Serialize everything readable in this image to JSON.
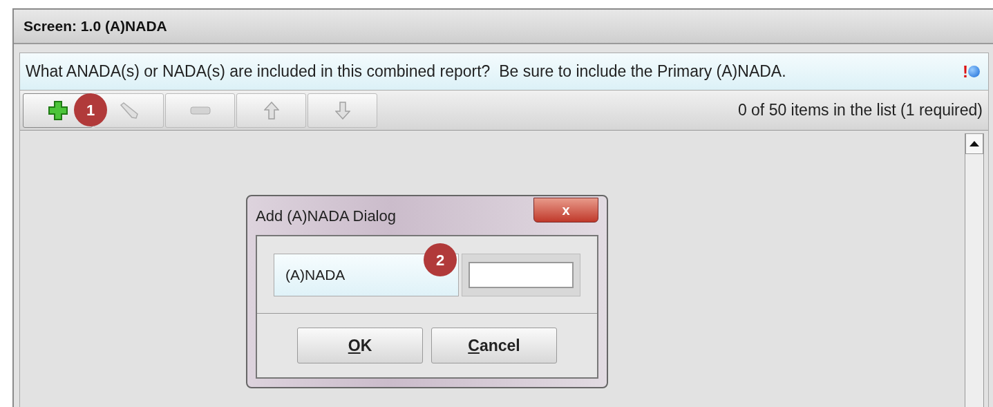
{
  "screen": {
    "title": "Screen: 1.0 (A)NADA"
  },
  "question": {
    "text": "What ANADA(s) or NADA(s) are included in this combined report?  Be sure to include the Primary (A)NADA.",
    "required_mark": "!"
  },
  "toolbar": {
    "buttons": [
      {
        "kind": "add",
        "disabled": false
      },
      {
        "kind": "edit",
        "disabled": true
      },
      {
        "kind": "remove",
        "disabled": true
      },
      {
        "kind": "up",
        "disabled": true
      },
      {
        "kind": "down",
        "disabled": true
      }
    ],
    "count_text": "0 of 50 items in the list (1 required)"
  },
  "callouts": [
    {
      "number": "1"
    },
    {
      "number": "2"
    }
  ],
  "dialog": {
    "title": "Add (A)NADA Dialog",
    "close_label": "x",
    "field_label": "(A)NADA",
    "buttons": [
      {
        "label": "OK",
        "underline_first": true
      },
      {
        "label": "Cancel",
        "underline_first": true
      }
    ]
  }
}
